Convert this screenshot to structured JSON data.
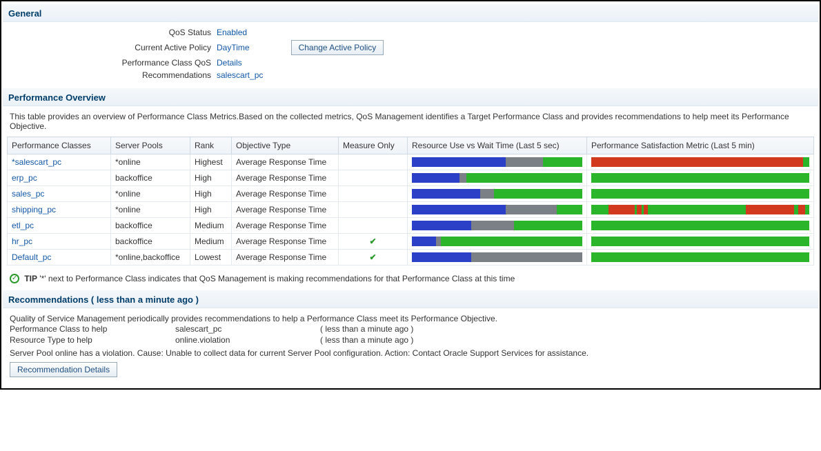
{
  "general": {
    "header": "General",
    "qos_status_label": "QoS Status",
    "qos_status_value": "Enabled",
    "active_policy_label": "Current Active Policy",
    "active_policy_value": "DayTime",
    "change_policy_btn": "Change Active Policy",
    "perf_class_qos_label": "Performance Class QoS",
    "perf_class_qos_value": "Details",
    "recommendations_label": "Recommendations",
    "recommendations_value": "salescart_pc"
  },
  "overview": {
    "header": "Performance Overview",
    "desc": "This table provides an overview of Performance Class Metrics.Based on the collected metrics, QoS Management identifies a Target Performance Class and provides recommendations to help meet its Performance Objective.",
    "columns": {
      "pc": "Performance Classes",
      "pool": "Server Pools",
      "rank": "Rank",
      "obj": "Objective Type",
      "meas": "Measure Only",
      "bar1": "Resource Use vs Wait Time (Last 5 sec)",
      "bar2": "Performance Satisfaction Metric (Last 5 min)"
    },
    "rows": [
      {
        "pc": "*salescart_pc",
        "pool": "*online",
        "rank": "Highest",
        "obj": "Average Response Time",
        "meas": false,
        "bar1": [
          [
            "blue",
            55
          ],
          [
            "gray",
            22
          ],
          [
            "green",
            23
          ]
        ],
        "bar2": [
          [
            "red",
            97
          ],
          [
            "green",
            3
          ]
        ]
      },
      {
        "pc": "erp_pc",
        "pool": "backoffice",
        "rank": "High",
        "obj": "Average Response Time",
        "meas": false,
        "bar1": [
          [
            "blue",
            28
          ],
          [
            "gray",
            4
          ],
          [
            "green",
            68
          ]
        ],
        "bar2": [
          [
            "green",
            100
          ]
        ]
      },
      {
        "pc": "sales_pc",
        "pool": "*online",
        "rank": "High",
        "obj": "Average Response Time",
        "meas": false,
        "bar1": [
          [
            "blue",
            40
          ],
          [
            "gray",
            8
          ],
          [
            "green",
            52
          ]
        ],
        "bar2": [
          [
            "green",
            100
          ]
        ]
      },
      {
        "pc": "shipping_pc",
        "pool": "*online",
        "rank": "High",
        "obj": "Average Response Time",
        "meas": false,
        "bar1": [
          [
            "blue",
            55
          ],
          [
            "gray",
            30
          ],
          [
            "green",
            15
          ]
        ],
        "bar2": [
          [
            "green",
            8
          ],
          [
            "red",
            12
          ],
          [
            "green",
            1
          ],
          [
            "red",
            2
          ],
          [
            "green",
            1
          ],
          [
            "red",
            2
          ],
          [
            "green",
            45
          ],
          [
            "red",
            22
          ],
          [
            "green",
            2
          ],
          [
            "red",
            3
          ],
          [
            "green",
            2
          ]
        ]
      },
      {
        "pc": "etl_pc",
        "pool": "backoffice",
        "rank": "Medium",
        "obj": "Average Response Time",
        "meas": false,
        "bar1": [
          [
            "blue",
            35
          ],
          [
            "gray",
            25
          ],
          [
            "green",
            40
          ]
        ],
        "bar2": [
          [
            "green",
            100
          ]
        ]
      },
      {
        "pc": "hr_pc",
        "pool": "backoffice",
        "rank": "Medium",
        "obj": "Average Response Time",
        "meas": true,
        "bar1": [
          [
            "blue",
            14
          ],
          [
            "gray",
            3
          ],
          [
            "green",
            83
          ]
        ],
        "bar2": [
          [
            "green",
            100
          ]
        ]
      },
      {
        "pc": "Default_pc",
        "pool": "*online,backoffice",
        "rank": "Lowest",
        "obj": "Average Response Time",
        "meas": true,
        "bar1": [
          [
            "blue",
            35
          ],
          [
            "gray",
            65
          ]
        ],
        "bar2": [
          [
            "green",
            100
          ]
        ]
      }
    ],
    "tip_bold": "TIP",
    "tip_text": " '*' next to Performance Class indicates that QoS Management is making recommendations for that Performance Class at this time"
  },
  "recommendations": {
    "header": "Recommendations ( less than a minute ago )",
    "desc": "Quality of Service Management periodically provides recommendations to help a Performance Class meet its Performance Objective.",
    "pc_help_label": "Performance Class to help",
    "pc_help_value": "salescart_pc",
    "pc_help_time": "( less than a minute ago )",
    "res_help_label": "Resource Type to help",
    "res_help_value": "online.violation",
    "res_help_time": "( less than a minute ago )",
    "msg": "Server Pool online has a violation. Cause: Unable to collect data for current Server Pool configuration. Action: Contact Oracle Support Services for assistance.",
    "details_btn": "Recommendation Details"
  }
}
